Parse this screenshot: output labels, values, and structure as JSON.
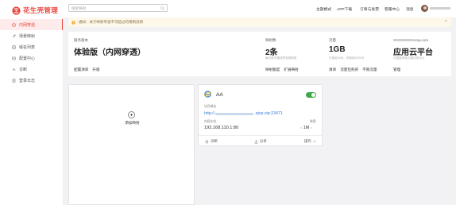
{
  "app": {
    "name": "花生壳管理",
    "brand_color": "#e8473f"
  },
  "sidebar": {
    "items": [
      {
        "label": "内网穿透",
        "icon": "tunnel-icon",
        "active": true
      },
      {
        "label": "场景映射",
        "icon": "scene-mapping-icon",
        "active": false
      },
      {
        "label": "域名列表",
        "icon": "domain-list-icon",
        "active": false
      },
      {
        "label": "配置中心",
        "icon": "config-center-icon",
        "active": false
      },
      {
        "label": "诊断",
        "icon": "diagnose-icon",
        "active": false
      },
      {
        "label": "登录日志",
        "icon": "login-log-icon",
        "active": false
      }
    ]
  },
  "topbar": {
    "search_placeholder": "搜索映射",
    "menu": [
      "主题模式",
      "APP下载",
      "订单与发票",
      "客服中心",
      "消息"
    ]
  },
  "notice": {
    "text": "通知：关于映射带宽不可超过的限制说明",
    "close": "×"
  },
  "info": {
    "version": {
      "label": "服务版本",
      "value": "体验版（内网穿透）",
      "links": [
        "配置清单",
        "升级"
      ]
    },
    "mappings": {
      "label": "映射数",
      "value": "2条",
      "sub": "每月首次赠送的免费映射",
      "links": [
        "映射额度",
        "扩展映射"
      ]
    },
    "traffic": {
      "label": "流量",
      "value": "1GB",
      "sub": "已使用1MB，将使用1GB/月",
      "links": [
        "清单",
        "流量包购买",
        "不限流量"
      ]
    },
    "platform": {
      "label_suffix": "oray.com",
      "value": "应用云平台",
      "sub": "可直接体验云端应用中心",
      "links": [
        "管理"
      ]
    }
  },
  "add_card": {
    "label": "添加映射"
  },
  "mapping_card": {
    "name": "AA",
    "enabled": true,
    "address_label": "访问地址",
    "address_prefix": "http://",
    "address_suffix": ".qicp.vip:23471",
    "host_label": "内网主机",
    "host": "192.168.110.1:80",
    "bandwidth_label": "带宽",
    "bandwidth": "1M",
    "actions": [
      "诊断",
      "分享",
      "操作"
    ]
  }
}
